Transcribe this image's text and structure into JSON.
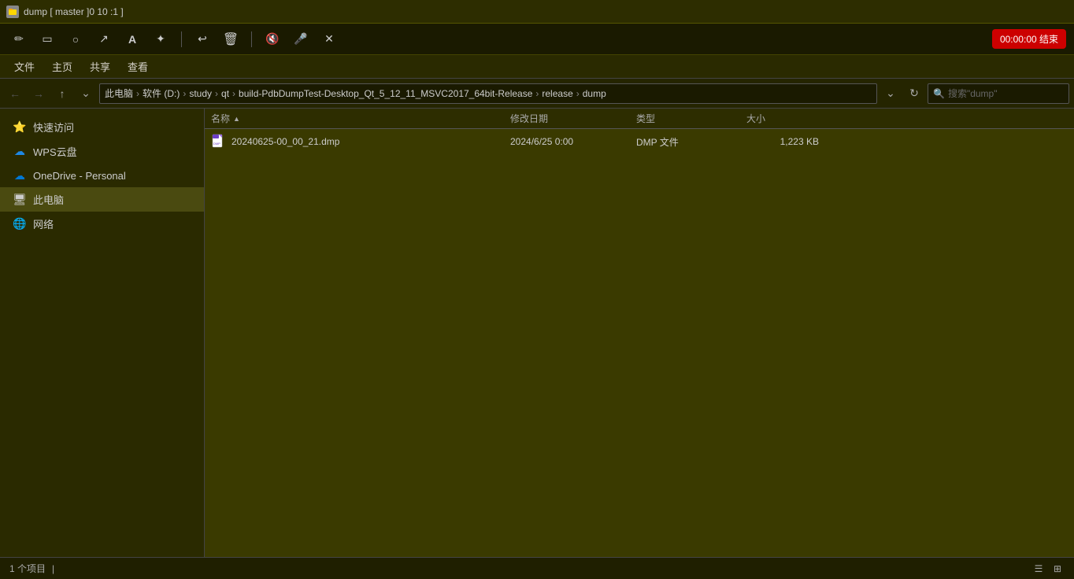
{
  "titlebar": {
    "icon": "folder",
    "title": "dump [ master ]0 10 :1 ]"
  },
  "annotation_bar": {
    "tools": [
      {
        "name": "pen",
        "symbol": "✏️"
      },
      {
        "name": "rectangle",
        "symbol": "▭"
      },
      {
        "name": "circle",
        "symbol": "○"
      },
      {
        "name": "arrow",
        "symbol": "↗"
      },
      {
        "name": "text",
        "symbol": "A"
      },
      {
        "name": "highlight",
        "symbol": "✦"
      },
      {
        "name": "undo",
        "symbol": "↩"
      },
      {
        "name": "delete",
        "symbol": "🗑"
      },
      {
        "name": "audio-off",
        "symbol": "🔇"
      },
      {
        "name": "mic",
        "symbol": "🎤"
      },
      {
        "name": "close",
        "symbol": "✕"
      }
    ],
    "record_btn": "00:00:00 结束"
  },
  "menubar": {
    "items": [
      "文件",
      "主页",
      "共享",
      "查看"
    ]
  },
  "addressbar": {
    "breadcrumb": [
      {
        "label": "此电脑"
      },
      {
        "label": "软件 (D:)"
      },
      {
        "label": "study"
      },
      {
        "label": "qt"
      },
      {
        "label": "build-PdbDumpTest-Desktop_Qt_5_12_11_MSVC2017_64bit-Release"
      },
      {
        "label": "release"
      },
      {
        "label": "dump"
      }
    ],
    "search_placeholder": "搜索\"dump\"",
    "refresh_hint": "刷新"
  },
  "sidebar": {
    "items": [
      {
        "label": "快速访问",
        "icon": "⭐",
        "type": "quickaccess"
      },
      {
        "label": "WPS云盘",
        "icon": "☁",
        "type": "wps"
      },
      {
        "label": "OneDrive - Personal",
        "icon": "☁",
        "type": "onedrive"
      },
      {
        "label": "此电脑",
        "icon": "🖥",
        "type": "thispc",
        "active": true
      },
      {
        "label": "网络",
        "icon": "🌐",
        "type": "network"
      }
    ]
  },
  "file_list": {
    "columns": [
      {
        "label": "名称",
        "key": "name"
      },
      {
        "label": "修改日期",
        "key": "date"
      },
      {
        "label": "类型",
        "key": "type"
      },
      {
        "label": "大小",
        "key": "size"
      }
    ],
    "files": [
      {
        "name": "20240625-00_00_21.dmp",
        "date": "2024/6/25 0:00",
        "type": "DMP 文件",
        "size": "1,223 KB",
        "icon": "dmp"
      }
    ]
  },
  "statusbar": {
    "item_count": "1 个项目",
    "separator": "|"
  }
}
